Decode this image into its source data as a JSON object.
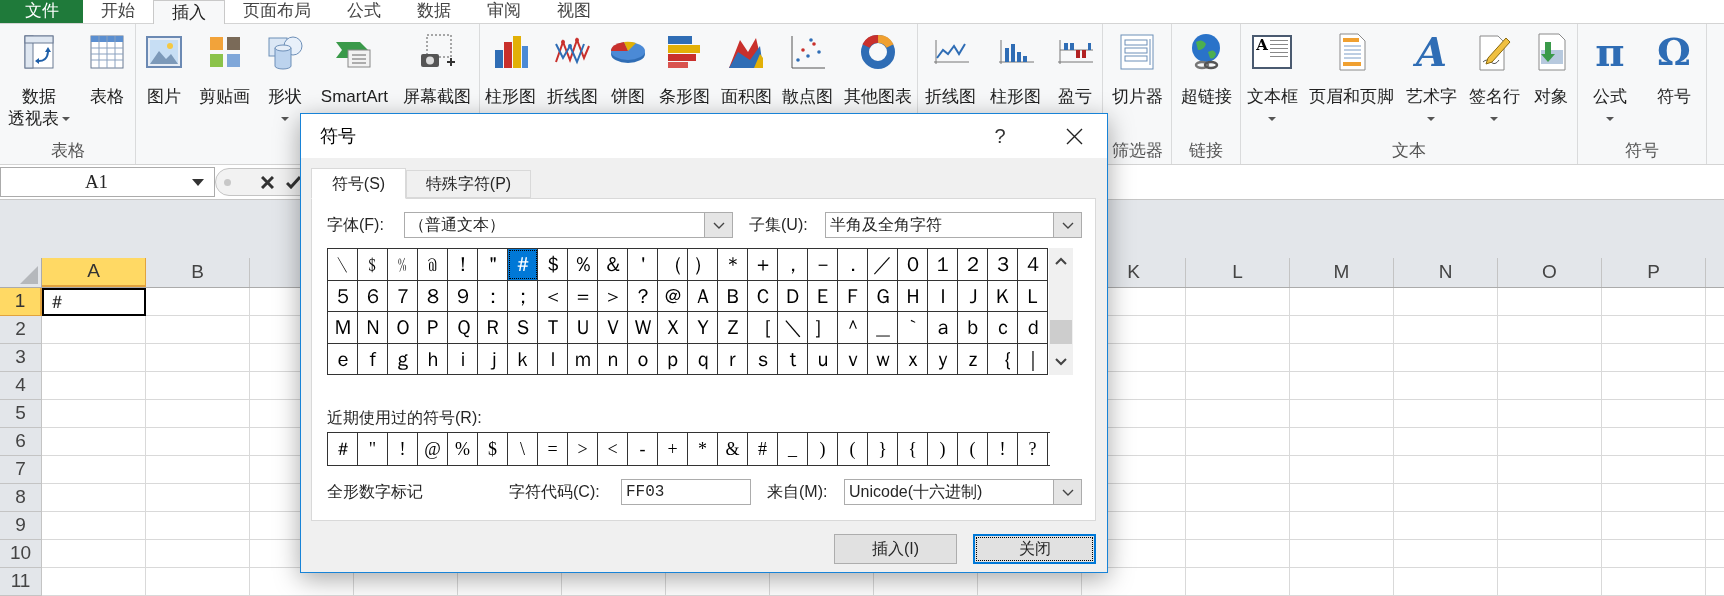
{
  "tabs": [
    {
      "label": "文件",
      "kind": "file",
      "selected": false
    },
    {
      "label": "开始",
      "kind": "tab",
      "selected": false
    },
    {
      "label": "插入",
      "kind": "tab",
      "selected": true
    },
    {
      "label": "页面布局",
      "kind": "tab",
      "selected": false
    },
    {
      "label": "公式",
      "kind": "tab",
      "selected": false
    },
    {
      "label": "数据",
      "kind": "tab",
      "selected": false
    },
    {
      "label": "审阅",
      "kind": "tab",
      "selected": false
    },
    {
      "label": "视图",
      "kind": "tab",
      "selected": false
    }
  ],
  "ribbon_groups": [
    {
      "label": "表格",
      "items": [
        {
          "kind": "pivot",
          "label": "数据",
          "label_2": "透视表",
          "dropdown": true
        },
        {
          "kind": "table",
          "label": "表格",
          "dropdown": false
        }
      ]
    },
    {
      "items": [
        {
          "kind": "picture",
          "label": "图片",
          "dropdown": false
        },
        {
          "kind": "clipart",
          "label": "剪贴画",
          "dropdown": false
        },
        {
          "kind": "shapes",
          "label": "形状",
          "dropdown": true
        },
        {
          "kind": "smartart",
          "label": "SmartArt",
          "dropdown": false
        },
        {
          "kind": "screenshot",
          "label": "屏幕截图",
          "dropdown": false
        }
      ]
    },
    {
      "items": [
        {
          "kind": "column",
          "label": "柱形图",
          "dropdown": false
        },
        {
          "kind": "line",
          "label": "折线图",
          "dropdown": false
        },
        {
          "kind": "pie",
          "label": "饼图",
          "dropdown": false
        },
        {
          "kind": "bar",
          "label": "条形图",
          "dropdown": false
        },
        {
          "kind": "area",
          "label": "面积图",
          "dropdown": false
        },
        {
          "kind": "scatter",
          "label": "散点图",
          "dropdown": false
        },
        {
          "kind": "other",
          "label": "其他图表",
          "dropdown": false
        }
      ]
    },
    {
      "items": [
        {
          "kind": "sparkline",
          "label": "折线图",
          "dropdown": false
        },
        {
          "kind": "sparkcolumn",
          "label": "柱形图",
          "dropdown": false
        },
        {
          "kind": "winloss",
          "label": "盈亏",
          "dropdown": false
        }
      ]
    },
    {
      "label": "筛选器",
      "items": [
        {
          "kind": "slicer",
          "label": "切片器",
          "dropdown": false
        }
      ]
    },
    {
      "label": "链接",
      "items": [
        {
          "kind": "hyperlink",
          "label": "超链接",
          "dropdown": false
        }
      ]
    },
    {
      "label": "文本",
      "items": [
        {
          "kind": "textbox",
          "glyph": "A",
          "label": "文本框",
          "dropdown": true
        },
        {
          "kind": "header",
          "label": "页眉和页脚",
          "dropdown": false
        },
        {
          "kind": "wordart",
          "glyph": "A",
          "label": "艺术字",
          "dropdown": true
        },
        {
          "kind": "signature",
          "label": "签名行",
          "dropdown": true
        },
        {
          "kind": "object",
          "label": "对象",
          "dropdown": false
        }
      ]
    },
    {
      "label": "符号",
      "items": [
        {
          "kind": "equation",
          "glyph": "π",
          "label": "公式",
          "dropdown": true
        },
        {
          "kind": "symbol",
          "glyph": "Ω",
          "label": "符号",
          "dropdown": false
        }
      ]
    }
  ],
  "formula_bar": {
    "name_box": "A1"
  },
  "sheet": {
    "columns": [
      {
        "label": "A",
        "selected": true
      },
      {
        "label": "B",
        "selected": false
      },
      {
        "label": "K",
        "selected": false
      },
      {
        "label": "L",
        "selected": false
      },
      {
        "label": "M",
        "selected": false
      },
      {
        "label": "N",
        "selected": false
      },
      {
        "label": "O",
        "selected": false
      },
      {
        "label": "P",
        "selected": false
      }
    ],
    "rows": [
      {
        "label": "1",
        "selected": true
      },
      {
        "label": "2",
        "selected": false
      },
      {
        "label": "3",
        "selected": false
      },
      {
        "label": "4",
        "selected": false
      },
      {
        "label": "5",
        "selected": false
      },
      {
        "label": "6",
        "selected": false
      },
      {
        "label": "7",
        "selected": false
      },
      {
        "label": "8",
        "selected": false
      },
      {
        "label": "9",
        "selected": false
      },
      {
        "label": "10",
        "selected": false
      },
      {
        "label": "11",
        "selected": false
      }
    ],
    "active_cell": {
      "value": "＃"
    }
  },
  "dialog": {
    "title": "符号",
    "help": "?",
    "tabs": [
      {
        "label": "符号(S)",
        "selected": true
      },
      {
        "label": "特殊字符(P)",
        "selected": false
      }
    ],
    "font_label": "字体(F):",
    "font_value": "（普通文本）",
    "subset_label": "子集(U):",
    "subset_value": "半角及全角字符",
    "grid": [
      [
        {
          "c": "﹨",
          "selected": false
        },
        {
          "c": "﹩",
          "selected": false
        },
        {
          "c": "﹪",
          "selected": false
        },
        {
          "c": "﹫",
          "selected": false
        },
        {
          "c": "！",
          "selected": false
        },
        {
          "c": "＂",
          "selected": false
        },
        {
          "c": "＃",
          "selected": true
        },
        {
          "c": "＄",
          "selected": false
        },
        {
          "c": "％",
          "selected": false
        },
        {
          "c": "＆",
          "selected": false
        },
        {
          "c": "＇",
          "selected": false
        },
        {
          "c": "（",
          "selected": false
        },
        {
          "c": "）",
          "selected": false
        },
        {
          "c": "＊",
          "selected": false
        },
        {
          "c": "＋",
          "selected": false
        },
        {
          "c": "，",
          "selected": false
        },
        {
          "c": "－",
          "selected": false
        },
        {
          "c": "．",
          "selected": false
        },
        {
          "c": "／",
          "selected": false
        },
        {
          "c": "０",
          "selected": false
        },
        {
          "c": "１",
          "selected": false
        },
        {
          "c": "２",
          "selected": false
        },
        {
          "c": "３",
          "selected": false
        },
        {
          "c": "４",
          "selected": false
        }
      ],
      [
        {
          "c": "５",
          "selected": false
        },
        {
          "c": "６",
          "selected": false
        },
        {
          "c": "７",
          "selected": false
        },
        {
          "c": "８",
          "selected": false
        },
        {
          "c": "９",
          "selected": false
        },
        {
          "c": "：",
          "selected": false
        },
        {
          "c": "；",
          "selected": false
        },
        {
          "c": "＜",
          "selected": false
        },
        {
          "c": "＝",
          "selected": false
        },
        {
          "c": "＞",
          "selected": false
        },
        {
          "c": "？",
          "selected": false
        },
        {
          "c": "＠",
          "selected": false
        },
        {
          "c": "Ａ",
          "selected": false
        },
        {
          "c": "Ｂ",
          "selected": false
        },
        {
          "c": "Ｃ",
          "selected": false
        },
        {
          "c": "Ｄ",
          "selected": false
        },
        {
          "c": "Ｅ",
          "selected": false
        },
        {
          "c": "Ｆ",
          "selected": false
        },
        {
          "c": "Ｇ",
          "selected": false
        },
        {
          "c": "Ｈ",
          "selected": false
        },
        {
          "c": "Ｉ",
          "selected": false
        },
        {
          "c": "Ｊ",
          "selected": false
        },
        {
          "c": "Ｋ",
          "selected": false
        },
        {
          "c": "Ｌ",
          "selected": false
        }
      ],
      [
        {
          "c": "Ｍ",
          "selected": false
        },
        {
          "c": "Ｎ",
          "selected": false
        },
        {
          "c": "Ｏ",
          "selected": false
        },
        {
          "c": "Ｐ",
          "selected": false
        },
        {
          "c": "Ｑ",
          "selected": false
        },
        {
          "c": "Ｒ",
          "selected": false
        },
        {
          "c": "Ｓ",
          "selected": false
        },
        {
          "c": "Ｔ",
          "selected": false
        },
        {
          "c": "Ｕ",
          "selected": false
        },
        {
          "c": "Ｖ",
          "selected": false
        },
        {
          "c": "Ｗ",
          "selected": false
        },
        {
          "c": "Ｘ",
          "selected": false
        },
        {
          "c": "Ｙ",
          "selected": false
        },
        {
          "c": "Ｚ",
          "selected": false
        },
        {
          "c": "［",
          "selected": false
        },
        {
          "c": "＼",
          "selected": false
        },
        {
          "c": "］",
          "selected": false
        },
        {
          "c": "＾",
          "selected": false
        },
        {
          "c": "＿",
          "selected": false
        },
        {
          "c": "｀",
          "selected": false
        },
        {
          "c": "ａ",
          "selected": false
        },
        {
          "c": "ｂ",
          "selected": false
        },
        {
          "c": "ｃ",
          "selected": false
        },
        {
          "c": "ｄ",
          "selected": false
        }
      ],
      [
        {
          "c": "ｅ",
          "selected": false
        },
        {
          "c": "ｆ",
          "selected": false
        },
        {
          "c": "ｇ",
          "selected": false
        },
        {
          "c": "ｈ",
          "selected": false
        },
        {
          "c": "ｉ",
          "selected": false
        },
        {
          "c": "ｊ",
          "selected": false
        },
        {
          "c": "ｋ",
          "selected": false
        },
        {
          "c": "ｌ",
          "selected": false
        },
        {
          "c": "ｍ",
          "selected": false
        },
        {
          "c": "ｎ",
          "selected": false
        },
        {
          "c": "ｏ",
          "selected": false
        },
        {
          "c": "ｐ",
          "selected": false
        },
        {
          "c": "ｑ",
          "selected": false
        },
        {
          "c": "ｒ",
          "selected": false
        },
        {
          "c": "ｓ",
          "selected": false
        },
        {
          "c": "ｔ",
          "selected": false
        },
        {
          "c": "ｕ",
          "selected": false
        },
        {
          "c": "ｖ",
          "selected": false
        },
        {
          "c": "ｗ",
          "selected": false
        },
        {
          "c": "ｘ",
          "selected": false
        },
        {
          "c": "ｙ",
          "selected": false
        },
        {
          "c": "ｚ",
          "selected": false
        },
        {
          "c": "｛",
          "selected": false
        },
        {
          "c": "｜",
          "selected": false
        }
      ]
    ],
    "recent_label": "近期使用过的符号(R):",
    "recent": [
      "＃",
      "\"",
      "!",
      "@",
      "%",
      "$",
      "\\",
      "=",
      ">",
      "<",
      "-",
      "+",
      "*",
      "&",
      "#",
      "_",
      ")",
      "(",
      "}",
      "{",
      ")",
      "(",
      "!",
      "?"
    ],
    "description": "全形数字标记",
    "code_label": "字符代码(C):",
    "code_value": "FF03",
    "from_label": "来自(M):",
    "from_value": "Unicode(十六进制)",
    "buttons": [
      {
        "label": "插入(I)",
        "focused": false
      },
      {
        "label": "关闭",
        "focused": true
      }
    ]
  }
}
